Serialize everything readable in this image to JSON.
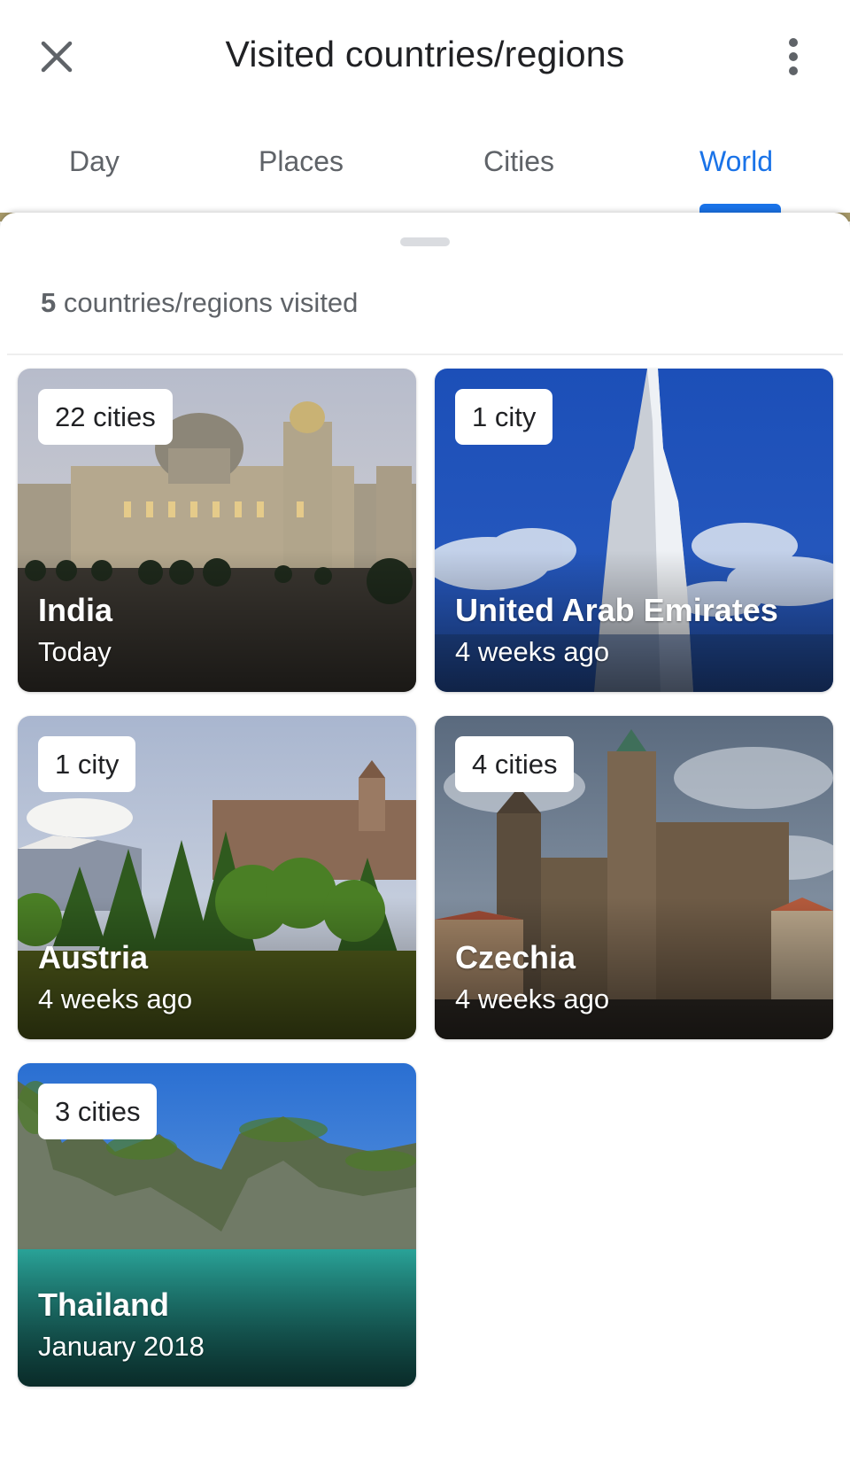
{
  "header": {
    "title": "Visited countries/regions",
    "close_icon": "close-icon",
    "more_icon": "more-vert-icon"
  },
  "tabs": [
    {
      "label": "Day",
      "active": false
    },
    {
      "label": "Places",
      "active": false
    },
    {
      "label": "Cities",
      "active": false
    },
    {
      "label": "World",
      "active": true
    }
  ],
  "summary": {
    "count": "5",
    "text": " countries/regions visited"
  },
  "countries": [
    {
      "name": "India",
      "badge": "22 cities",
      "date": "Today"
    },
    {
      "name": "United Arab Emirates",
      "badge": "1 city",
      "date": "4 weeks ago"
    },
    {
      "name": "Austria",
      "badge": "1 city",
      "date": "4 weeks ago"
    },
    {
      "name": "Czechia",
      "badge": "4 cities",
      "date": "4 weeks ago"
    },
    {
      "name": "Thailand",
      "badge": "3 cities",
      "date": "January 2018"
    }
  ],
  "colors": {
    "accent": "#1a73e8",
    "text_primary": "#202124",
    "text_secondary": "#5f6368"
  }
}
